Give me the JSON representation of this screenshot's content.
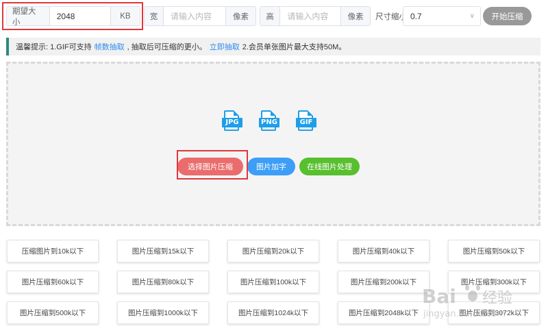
{
  "toolbar": {
    "size": {
      "label": "期望大小",
      "value": "2048",
      "unit": "KB"
    },
    "width": {
      "label": "宽",
      "placeholder": "请输入内容",
      "unit": "像素"
    },
    "height": {
      "label": "高",
      "placeholder": "请输入内容",
      "unit": "像素"
    },
    "scale": {
      "label": "尺寸缩小",
      "value": "0.7"
    },
    "start_label": "开始压缩"
  },
  "notice": {
    "prefix": "温馨提示: 1.GIF可支持",
    "link1": "帧数抽取",
    "mid": ", 抽取后可压缩的更小。",
    "link2": "立即抽取",
    "suffix": "2.会员单张图片最大支持50M。"
  },
  "dropzone": {
    "formats": [
      "JPG",
      "PNG",
      "GIF"
    ],
    "choose_label": "选择图片压缩",
    "text_label": "图片加字",
    "online_label": "在线图片处理"
  },
  "presets": [
    "压缩图片到10k以下",
    "图片压缩到15k以下",
    "图片压缩到20k以下",
    "图片压缩到40k以下",
    "图片压缩到50k以下",
    "图片压缩到60k以下",
    "图片压缩到80k以下",
    "图片压缩到100k以下",
    "图片压缩到200k以下",
    "图片压缩到300k以下",
    "图片压缩到500k以下",
    "图片压缩到1000k以下",
    "图片压缩到1024k以下",
    "图片压缩到2048k以下",
    "图片压缩到3072k以下"
  ],
  "watermark": {
    "brand": "Bai",
    "brand2": "经验",
    "domain": "jingyan.baidu.com"
  },
  "colors": {
    "accent_blue": "#1f9ee8",
    "choose": "#ea6c6c",
    "text_btn": "#3c9ef7",
    "online": "#58bf2e",
    "notice_bar": "#2b8a78",
    "highlight": "#e0363a"
  }
}
